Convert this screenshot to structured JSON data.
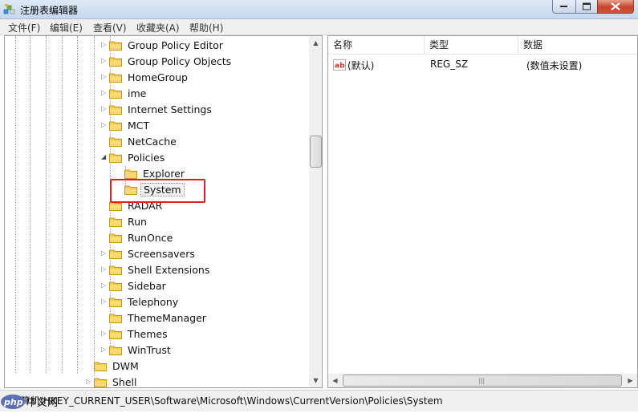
{
  "window": {
    "title": "注册表编辑器"
  },
  "menu": [
    "文件(F)",
    "编辑(E)",
    "查看(V)",
    "收藏夹(A)",
    "帮助(H)"
  ],
  "tree": {
    "items": [
      {
        "label": "Group Policy Editor",
        "expander": "collapsed"
      },
      {
        "label": "Group Policy Objects",
        "expander": "collapsed"
      },
      {
        "label": "HomeGroup",
        "expander": "collapsed"
      },
      {
        "label": "ime",
        "expander": "collapsed"
      },
      {
        "label": "Internet Settings",
        "expander": "collapsed"
      },
      {
        "label": "MCT",
        "expander": "collapsed"
      },
      {
        "label": "NetCache",
        "expander": "none"
      },
      {
        "label": "Policies",
        "expander": "expanded"
      },
      {
        "label": "Explorer",
        "expander": "none"
      },
      {
        "label": "System",
        "expander": "none",
        "selected": true
      },
      {
        "label": "RADAR",
        "expander": "none"
      },
      {
        "label": "Run",
        "expander": "none"
      },
      {
        "label": "RunOnce",
        "expander": "none"
      },
      {
        "label": "Screensavers",
        "expander": "collapsed"
      },
      {
        "label": "Shell Extensions",
        "expander": "collapsed"
      },
      {
        "label": "Sidebar",
        "expander": "collapsed"
      },
      {
        "label": "Telephony",
        "expander": "collapsed"
      },
      {
        "label": "ThemeManager",
        "expander": "none"
      },
      {
        "label": "Themes",
        "expander": "collapsed"
      },
      {
        "label": "WinTrust",
        "expander": "collapsed"
      },
      {
        "label": "DWM",
        "expander": "none"
      },
      {
        "label": "Shell",
        "expander": "collapsed"
      }
    ]
  },
  "list": {
    "columns": [
      "名称",
      "类型",
      "数据"
    ],
    "rows": [
      {
        "name": "(默认)",
        "type": "REG_SZ",
        "data": "(数值未设置)",
        "icon": "string-value-icon"
      }
    ]
  },
  "status": {
    "path": "计算机\\HKEY_CURRENT_USER\\Software\\Microsoft\\Windows\\CurrentVersion\\Policies\\System"
  },
  "watermark": {
    "text": "php中文网"
  },
  "colors": {
    "highlight": "#e02020",
    "folder": "#f2c94c",
    "titlebar": "#c6d8ee"
  }
}
